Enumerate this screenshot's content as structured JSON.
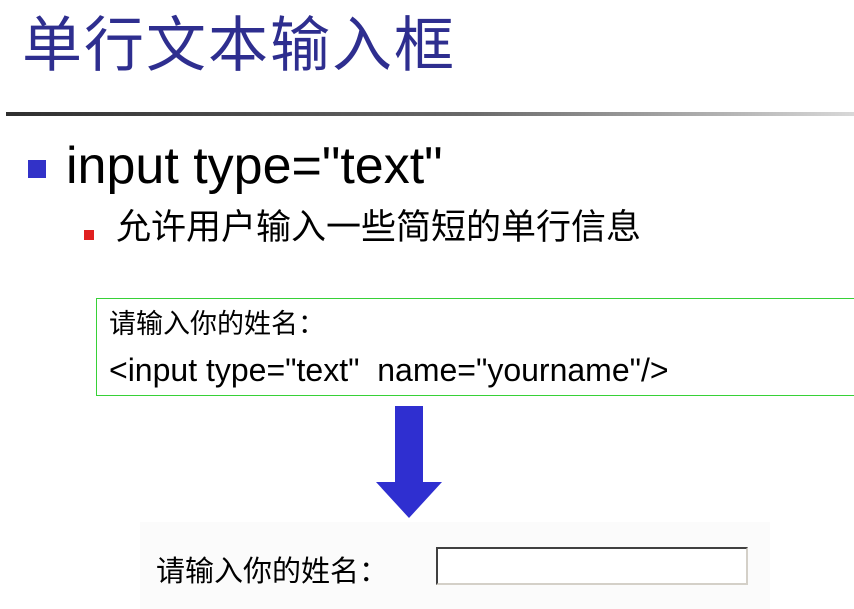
{
  "slide": {
    "title": "单行文本输入框"
  },
  "bullets": {
    "level1": "input type=\"text\"",
    "level2": "允许用户输入一些简短的单行信息"
  },
  "code_example": {
    "line1": "请输入你的姓名：",
    "line2": "<input type=\"text\"  name=\"yourname\"/>"
  },
  "demo": {
    "label": "请输入你的姓名：",
    "input_value": ""
  },
  "colors": {
    "title": "#2e2e8f",
    "bullet_level1": "#3232c8",
    "bullet_level2": "#e02020",
    "code_border": "#37d137",
    "arrow": "#2f2fd0"
  },
  "icons": {
    "arrow": "down-arrow-icon"
  }
}
